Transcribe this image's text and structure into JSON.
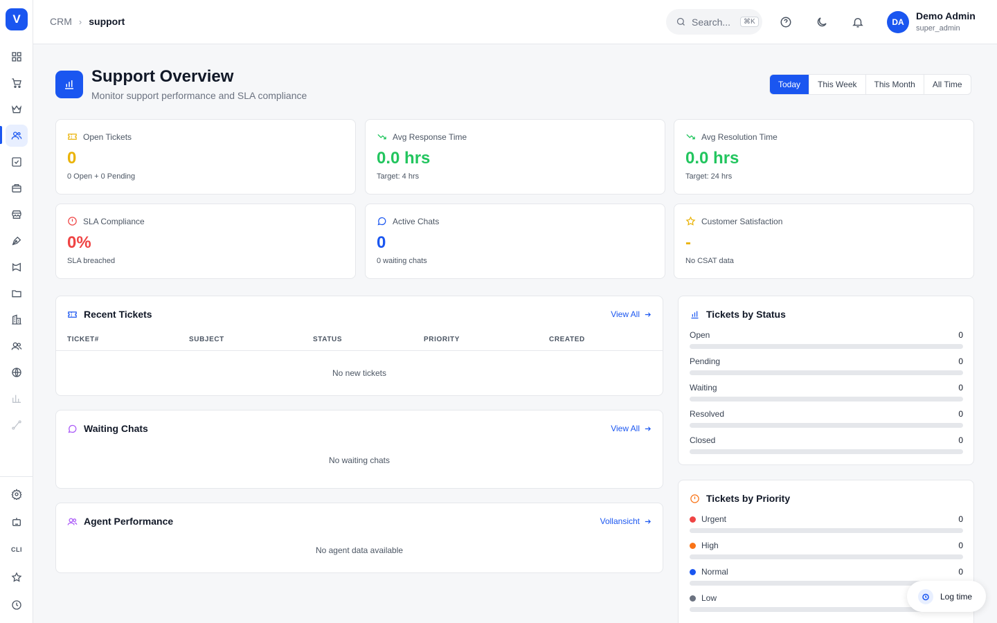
{
  "sidebar": {
    "logo": "V",
    "cli_label": "CLI",
    "icons": [
      "dashboard-icon",
      "cart-icon",
      "crown-icon",
      "users-icon",
      "checkbox-icon",
      "briefcase-icon",
      "store-icon",
      "pen-icon",
      "megaphone-icon",
      "folder-icon",
      "building-icon",
      "contacts-icon",
      "globe-icon",
      "chart-icon",
      "route-icon",
      "settings-icon",
      "bot-icon",
      "cli-icon",
      "star-icon",
      "clock-icon"
    ]
  },
  "header": {
    "breadcrumb_root": "CRM",
    "breadcrumb_current": "support",
    "search_placeholder": "Search...",
    "search_shortcut": "⌘K",
    "user_initials": "DA",
    "user_name": "Demo Admin",
    "user_role": "super_admin"
  },
  "page": {
    "title": "Support Overview",
    "subtitle": "Monitor support performance and SLA compliance",
    "periods": [
      "Today",
      "This Week",
      "This Month",
      "All Time"
    ],
    "active_period": "Today"
  },
  "stats": [
    {
      "label": "Open Tickets",
      "value": "0",
      "sub": "0 Open + 0 Pending",
      "color": "#eab308",
      "icon": "ticket-icon"
    },
    {
      "label": "Avg Response Time",
      "value": "0.0 hrs",
      "sub": "Target: 4 hrs",
      "color": "#22c55e",
      "icon": "trending-down-icon"
    },
    {
      "label": "Avg Resolution Time",
      "value": "0.0 hrs",
      "sub": "Target: 24 hrs",
      "color": "#22c55e",
      "icon": "trending-down-icon"
    },
    {
      "label": "SLA Compliance",
      "value": "0%",
      "sub": "SLA breached",
      "color": "#ef4444",
      "icon": "alert-circle-icon"
    },
    {
      "label": "Active Chats",
      "value": "0",
      "sub": "0 waiting chats",
      "color": "#1a56f0",
      "icon": "chat-icon"
    },
    {
      "label": "Customer Satisfaction",
      "value": "-",
      "sub": "No CSAT data",
      "color": "#eab308",
      "icon": "star-icon"
    }
  ],
  "recent_tickets": {
    "title": "Recent Tickets",
    "view_all": "View All",
    "columns": [
      "TICKET#",
      "SUBJECT",
      "STATUS",
      "PRIORITY",
      "CREATED"
    ],
    "empty": "No new tickets"
  },
  "waiting_chats": {
    "title": "Waiting Chats",
    "view_all": "View All",
    "empty": "No waiting chats"
  },
  "agent_performance": {
    "title": "Agent Performance",
    "view_all": "Vollansicht",
    "empty": "No agent data available"
  },
  "tickets_by_status": {
    "title": "Tickets by Status",
    "items": [
      {
        "label": "Open",
        "count": "0",
        "fraction": 0
      },
      {
        "label": "Pending",
        "count": "0",
        "fraction": 0
      },
      {
        "label": "Waiting",
        "count": "0",
        "fraction": 0
      },
      {
        "label": "Resolved",
        "count": "0",
        "fraction": 0
      },
      {
        "label": "Closed",
        "count": "0",
        "fraction": 0
      }
    ]
  },
  "tickets_by_priority": {
    "title": "Tickets by Priority",
    "items": [
      {
        "label": "Urgent",
        "count": "0",
        "color": "#ef4444",
        "fraction": 0
      },
      {
        "label": "High",
        "count": "0",
        "color": "#f97316",
        "fraction": 0
      },
      {
        "label": "Normal",
        "count": "0",
        "color": "#1a56f0",
        "fraction": 0
      },
      {
        "label": "Low",
        "count": "0",
        "color": "#6b7280",
        "fraction": 0
      }
    ]
  },
  "log_time": {
    "label": "Log time"
  },
  "colors": {
    "accent": "#1a56f0"
  }
}
